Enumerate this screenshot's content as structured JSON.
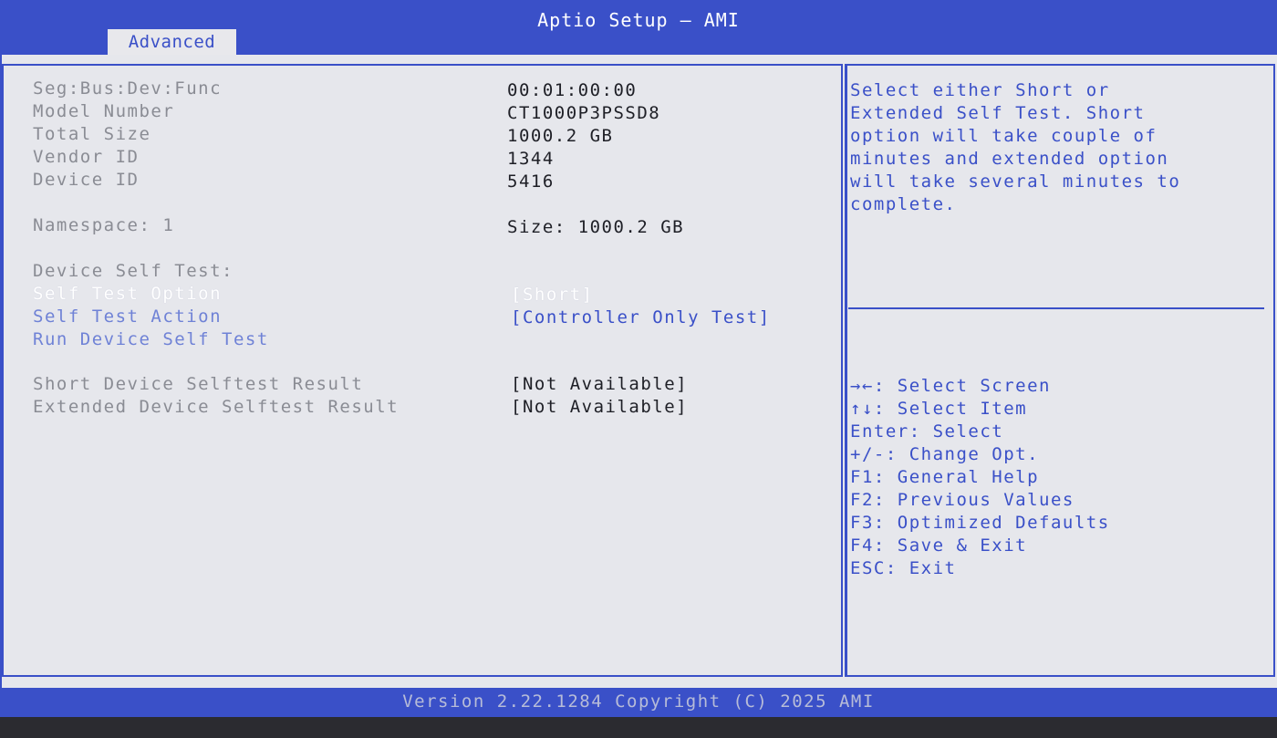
{
  "app": {
    "title": "Aptio Setup – AMI",
    "active_tab": "Advanced"
  },
  "device_info": [
    {
      "label": "Seg:Bus:Dev:Func",
      "value": "00:01:00:00"
    },
    {
      "label": "Model Number",
      "value": "CT1000P3PSSD8"
    },
    {
      "label": "Total Size",
      "value": "1000.2 GB"
    },
    {
      "label": "Vendor ID",
      "value": "1344"
    },
    {
      "label": "Device ID",
      "value": "5416"
    }
  ],
  "namespace": {
    "label": "Namespace: 1",
    "value": "Size: 1000.2 GB"
  },
  "self_test": {
    "heading": "Device Self Test:",
    "option_label": "Self Test Option",
    "option_value": "[Short]",
    "action_label": "Self Test Action",
    "action_value": "[Controller Only Test]",
    "run_label": "Run Device Self Test"
  },
  "results": [
    {
      "label": "Short Device Selftest Result",
      "value": "[Not Available]"
    },
    {
      "label": "Extended Device Selftest Result",
      "value": "[Not Available]"
    }
  ],
  "help_text": [
    "Select either Short or",
    "Extended Self Test. Short",
    "option will take couple of",
    "minutes and extended option",
    "will take several minutes to",
    "complete."
  ],
  "key_legend": [
    "→←: Select Screen",
    "↑↓: Select Item",
    "Enter: Select",
    "+/-: Change Opt.",
    "F1: General Help",
    "F2: Previous Values",
    "F3: Optimized Defaults",
    "F4: Save & Exit",
    "ESC: Exit"
  ],
  "footer": {
    "version": "Version 2.22.1284 Copyright (C) 2025 AMI"
  },
  "colors": {
    "accent_blue": "#3a50c8",
    "panel_bg": "#e6e7ec",
    "highlight": "#ffffff"
  }
}
